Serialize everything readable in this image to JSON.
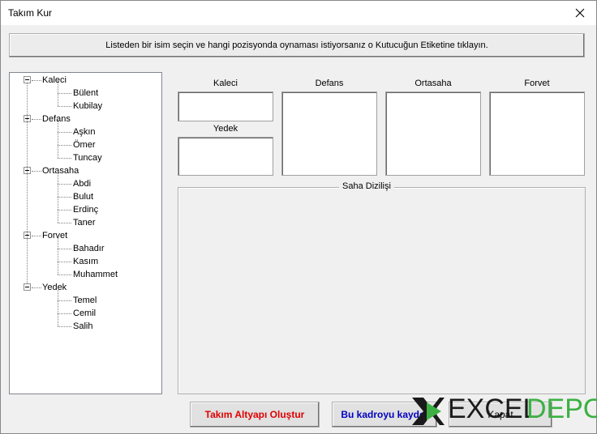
{
  "window": {
    "title": "Takım Kur"
  },
  "instruction": "Listeden bir isim seçin ve hangi pozisyonda oynaması istiyorsanız o Kutucuğun Etiketine tıklayın.",
  "tree": [
    {
      "label": "Kaleci",
      "children": [
        "Bülent",
        "Kubilay"
      ]
    },
    {
      "label": "Defans",
      "children": [
        "Aşkın",
        "Ömer",
        "Tuncay"
      ]
    },
    {
      "label": "Ortasaha",
      "children": [
        "Abdi",
        "Bulut",
        "Erdinç",
        "Taner"
      ]
    },
    {
      "label": "Forvet",
      "children": [
        "Bahadır",
        "Kasım",
        "Muhammet"
      ]
    },
    {
      "label": "Yedek",
      "children": [
        "Temel",
        "Cemil",
        "Salih"
      ]
    }
  ],
  "positions": {
    "kaleci": "Kaleci",
    "yedek": "Yedek",
    "defans": "Defans",
    "ortasaha": "Ortasaha",
    "forvet": "Forvet"
  },
  "frame_label": "Saha Dizilişi",
  "buttons": {
    "build": "Takım Altyapı Oluştur",
    "save": "Bu kadroyu kaydet",
    "close": "Kapat"
  },
  "colors": {
    "build": "#e00000",
    "save": "#0000c0",
    "logo_dark": "#1a1a1a",
    "logo_green": "#3cb043"
  },
  "logo": {
    "part1": "EXCEL",
    "part2": "DEPO"
  }
}
